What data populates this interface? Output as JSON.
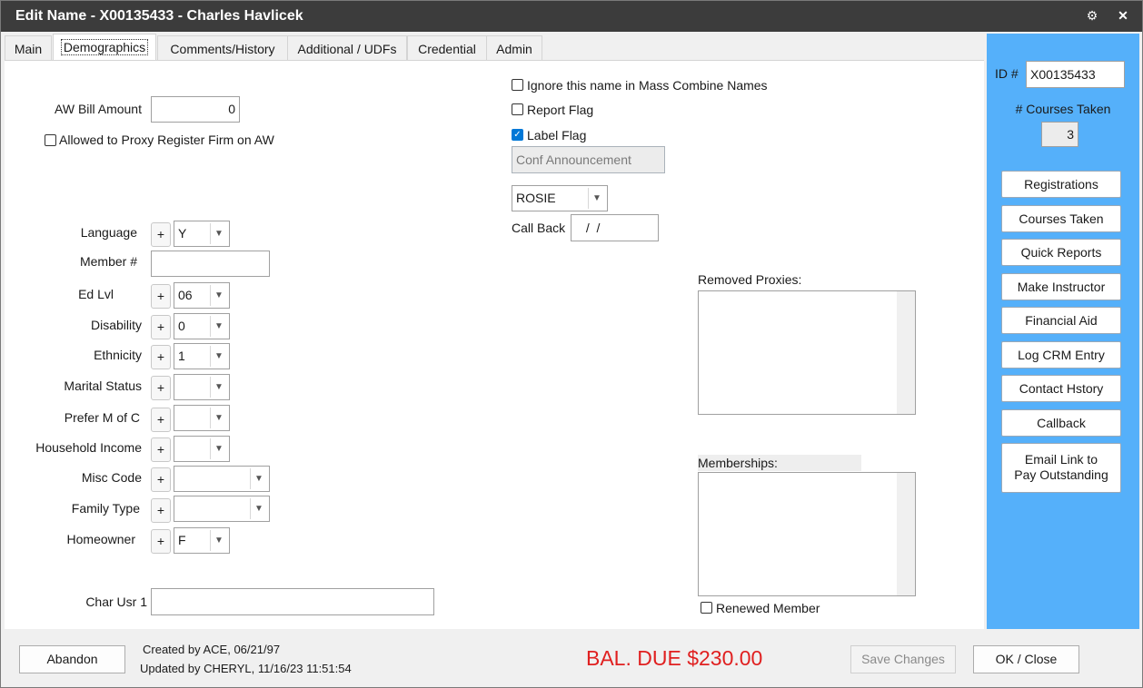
{
  "window": {
    "title": "Edit Name - X00135433 - Charles Havlicek"
  },
  "tabs": [
    {
      "label": "Main"
    },
    {
      "label": "Demographics"
    },
    {
      "label": "Comments/History"
    },
    {
      "label": "Additional / UDFs"
    },
    {
      "label": "Credential"
    },
    {
      "label": "Admin"
    }
  ],
  "demographics": {
    "aw_bill_label": "AW Bill Amount",
    "aw_bill_value": "0",
    "proxy_label": "Allowed to Proxy Register Firm on AW",
    "proxy_checked": false,
    "fields": [
      {
        "label": "Language",
        "value": "Y"
      },
      {
        "label": "Member #",
        "value": ""
      },
      {
        "label": "Ed Lvl",
        "value": "06"
      },
      {
        "label": "Disability",
        "value": "0"
      },
      {
        "label": "Ethnicity",
        "value": "1"
      },
      {
        "label": "Marital Status",
        "value": ""
      },
      {
        "label": "Prefer M of C",
        "value": ""
      },
      {
        "label": "Household Income",
        "value": ""
      },
      {
        "label": "Misc Code",
        "value": ""
      },
      {
        "label": "Family Type",
        "value": ""
      },
      {
        "label": "Homeowner",
        "value": "F"
      }
    ],
    "char_usr_label": "Char Usr 1",
    "char_usr_value": "",
    "ignore_label": "Ignore this name in Mass Combine Names",
    "report_flag_label": "Report Flag",
    "label_flag_label": "Label Flag",
    "label_flag_checked": true,
    "conf_placeholder": "Conf Announcement",
    "rosie_value": "ROSIE",
    "callback_label": "Call Back",
    "callback_value": " /  /",
    "removed_proxies_label": "Removed Proxies:",
    "memberships_label": "Memberships:",
    "renewed_label": "Renewed Member",
    "renewed_checked": false
  },
  "sidebar": {
    "id_label": "ID #",
    "id_value": "X00135433",
    "courses_taken_label": "# Courses Taken",
    "courses_taken_value": "3",
    "buttons": [
      {
        "label": "Registrations"
      },
      {
        "label": "Courses Taken"
      },
      {
        "label": "Quick Reports"
      },
      {
        "label": "Make Instructor"
      },
      {
        "label": "Financial Aid"
      },
      {
        "label": "Log CRM Entry"
      },
      {
        "label": "Contact Hstory"
      },
      {
        "label": "Callback"
      },
      {
        "label": "Email Link to",
        "label2": "Pay Outstanding"
      }
    ]
  },
  "footer": {
    "abandon": "Abandon",
    "created": "Created by ACE, 06/21/97",
    "updated": "Updated by CHERYL, 11/16/23 11:51:54",
    "balance": "BAL. DUE $230.00",
    "save": "Save Changes",
    "ok": "OK / Close"
  },
  "colors": {
    "title_bg": "#3c3c3c",
    "sidebar_bg": "#55b0fa",
    "balance": "#e02020",
    "checkbox_checked": "#0078d7"
  }
}
